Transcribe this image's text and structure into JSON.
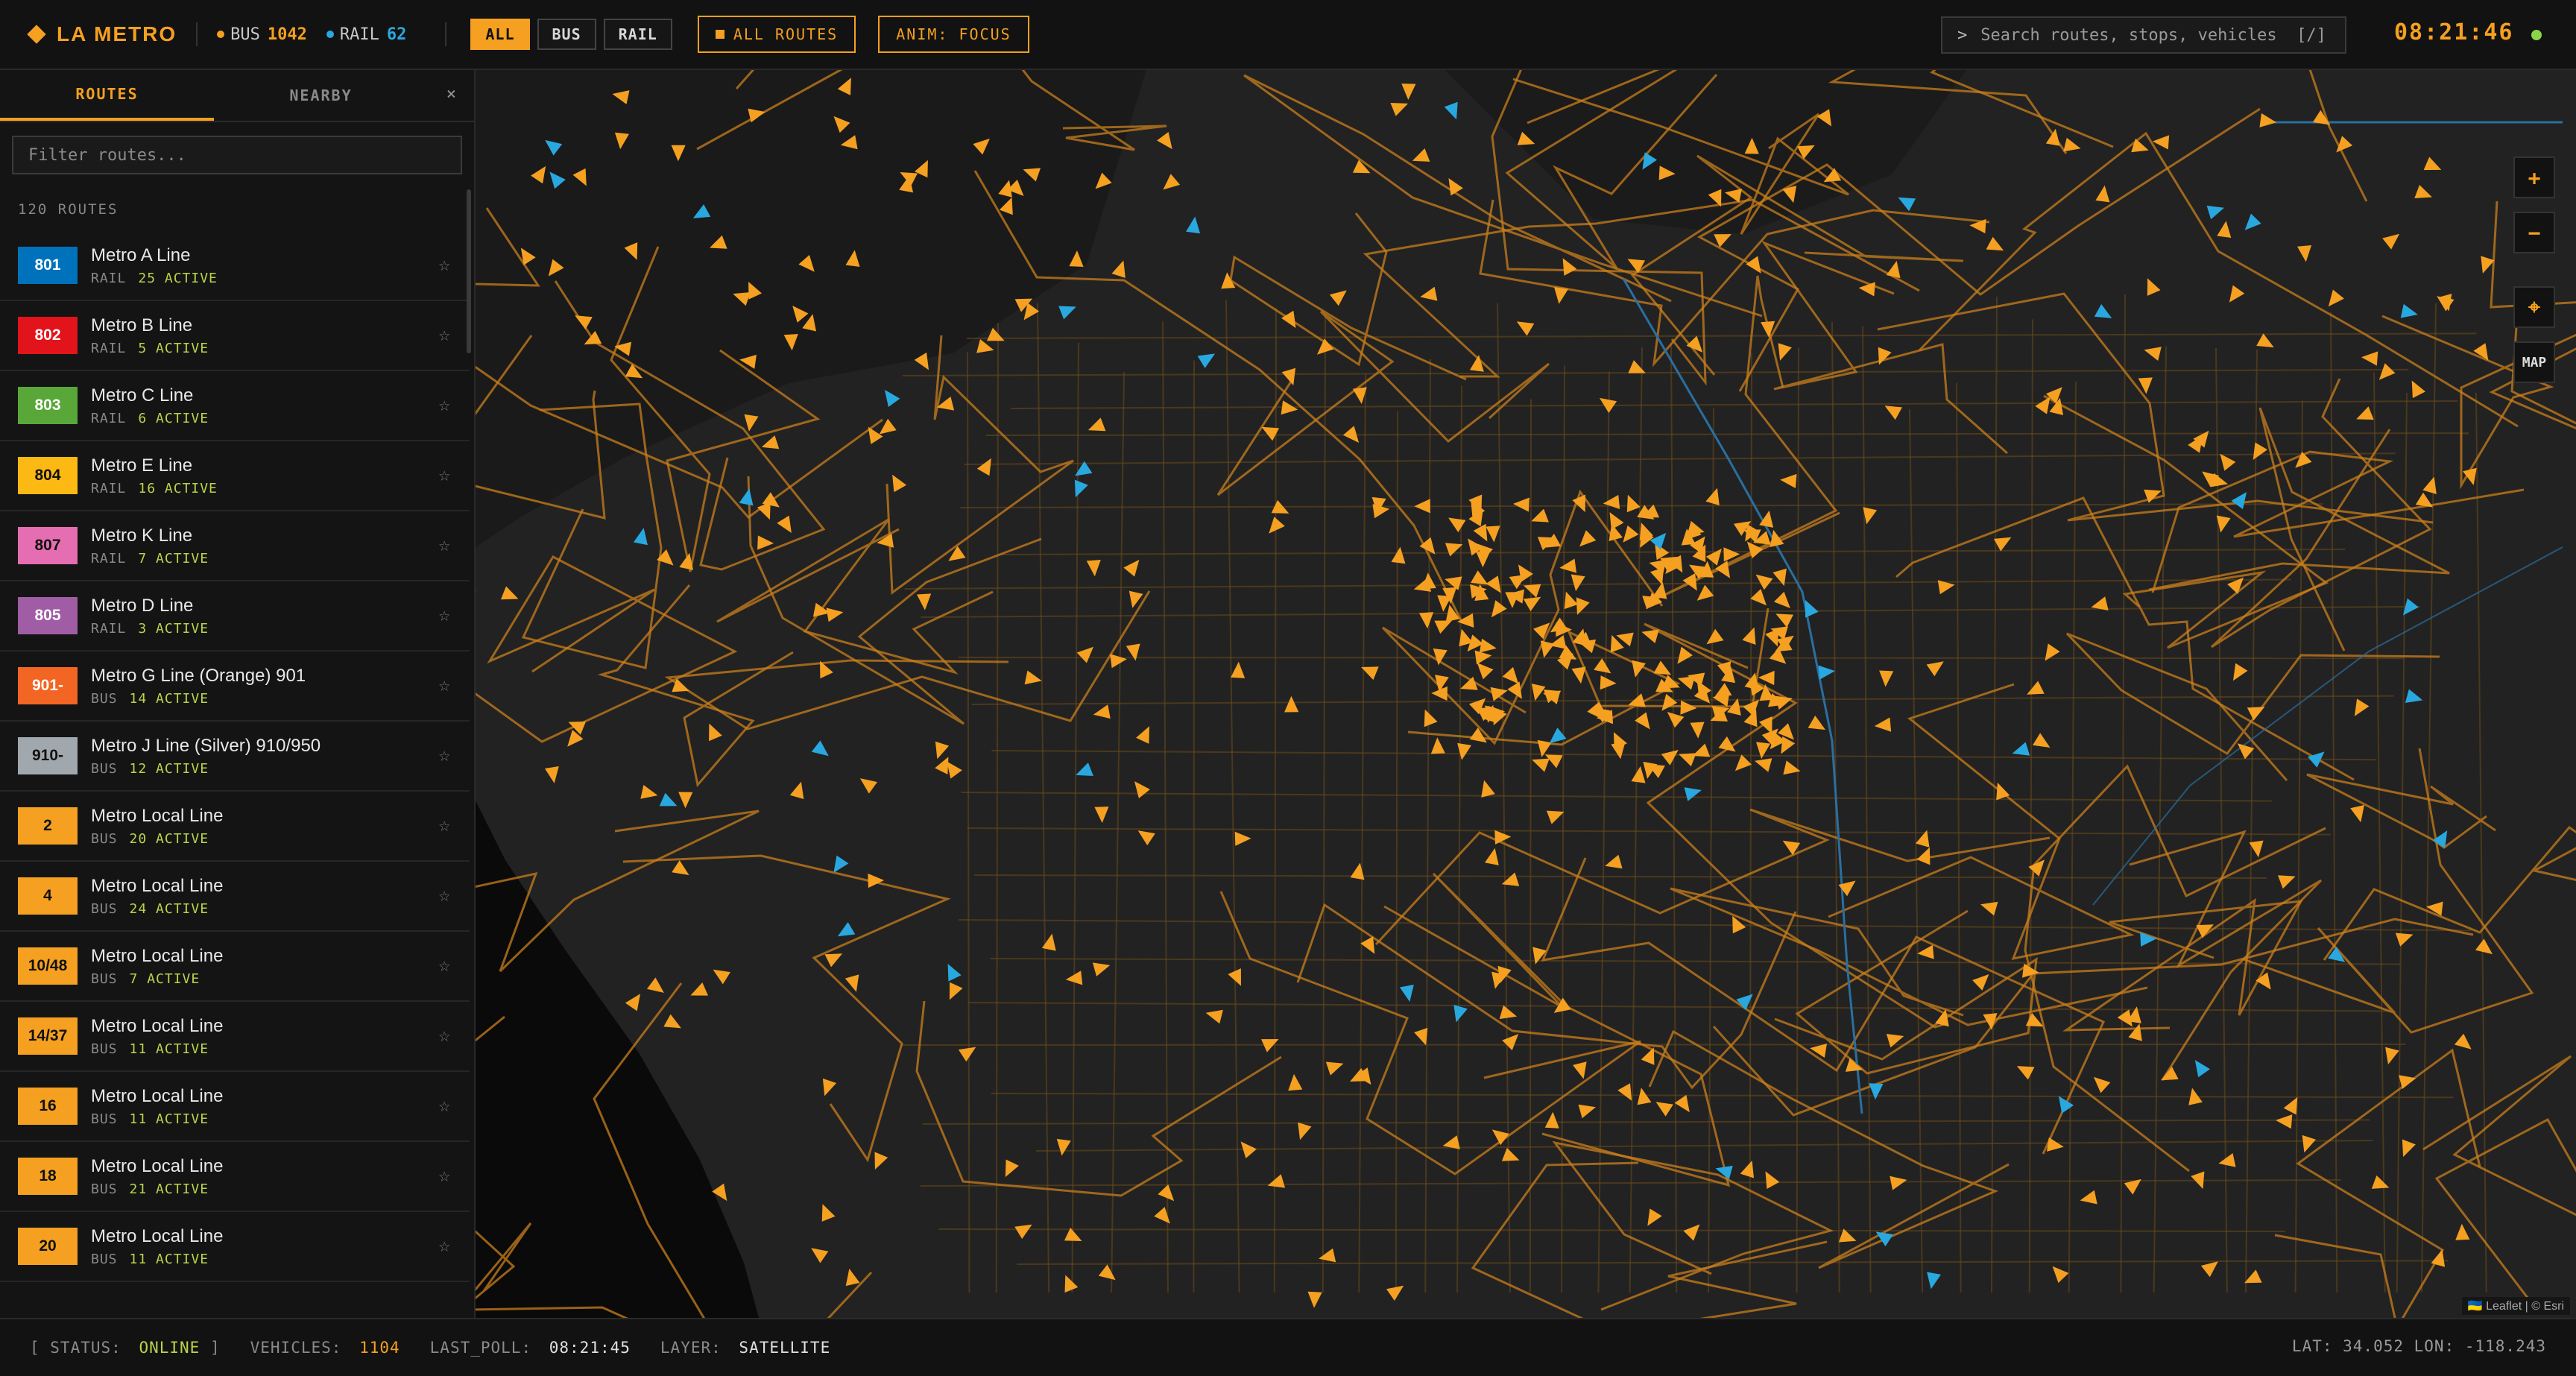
{
  "app": {
    "name": "LA METRO"
  },
  "counts": {
    "bus_label": "BUS",
    "bus_value": "1042",
    "rail_label": "RAIL",
    "rail_value": "62"
  },
  "filters": {
    "all": "ALL",
    "bus": "BUS",
    "rail": "RAIL",
    "selected": "ALL"
  },
  "buttons": {
    "all_routes": "ALL ROUTES",
    "anim": "ANIM: FOCUS"
  },
  "search": {
    "prompt": ">",
    "placeholder": "Search routes, stops, vehicles  [/]"
  },
  "clock": "08:21:46",
  "sidebar": {
    "tabs": [
      "ROUTES",
      "NEARBY"
    ],
    "close": "×",
    "filter_placeholder": "Filter routes...",
    "route_count": "120 ROUTES",
    "routes": [
      {
        "code": "801",
        "name": "Metro A Line",
        "mode": "RAIL",
        "active": "25 ACTIVE",
        "color": "#0072bc"
      },
      {
        "code": "802",
        "name": "Metro B Line",
        "mode": "RAIL",
        "active": "5 ACTIVE",
        "color": "#e3131b"
      },
      {
        "code": "803",
        "name": "Metro C Line",
        "mode": "RAIL",
        "active": "6 ACTIVE",
        "color": "#58a738"
      },
      {
        "code": "804",
        "name": "Metro E Line",
        "mode": "RAIL",
        "active": "16 ACTIVE",
        "color": "#fdb913"
      },
      {
        "code": "807",
        "name": "Metro K Line",
        "mode": "RAIL",
        "active": "7 ACTIVE",
        "color": "#e56db1"
      },
      {
        "code": "805",
        "name": "Metro D Line",
        "mode": "RAIL",
        "active": "3 ACTIVE",
        "color": "#a05da5"
      },
      {
        "code": "901-",
        "name": "Metro G Line (Orange) 901",
        "mode": "BUS",
        "active": "14 ACTIVE",
        "color": "#f26522"
      },
      {
        "code": "910-",
        "name": "Metro J Line (Silver) 910/950",
        "mode": "BUS",
        "active": "12 ACTIVE",
        "color": "#a1a8ad"
      },
      {
        "code": "2",
        "name": "Metro Local Line",
        "mode": "BUS",
        "active": "20 ACTIVE",
        "color": "#f5a020"
      },
      {
        "code": "4",
        "name": "Metro Local Line",
        "mode": "BUS",
        "active": "24 ACTIVE",
        "color": "#f5a020"
      },
      {
        "code": "10/48",
        "name": "Metro Local Line",
        "mode": "BUS",
        "active": "7 ACTIVE",
        "color": "#f5a020"
      },
      {
        "code": "14/37",
        "name": "Metro Local Line",
        "mode": "BUS",
        "active": "11 ACTIVE",
        "color": "#f5a020"
      },
      {
        "code": "16",
        "name": "Metro Local Line",
        "mode": "BUS",
        "active": "11 ACTIVE",
        "color": "#f5a020"
      },
      {
        "code": "18",
        "name": "Metro Local Line",
        "mode": "BUS",
        "active": "21 ACTIVE",
        "color": "#f5a020"
      },
      {
        "code": "20",
        "name": "Metro Local Line",
        "mode": "BUS",
        "active": "11 ACTIVE",
        "color": "#f5a020"
      }
    ]
  },
  "map": {
    "controls": {
      "zoom_in": "+",
      "zoom_out": "−",
      "locate": "⌖",
      "layer": "MAP"
    },
    "attribution": "🇺🇦 Leaflet | © Esri",
    "bus_color": "#f5a020",
    "rail_color": "#29a8e0"
  },
  "status": {
    "status_open": "[ STATUS:",
    "status_value": "ONLINE",
    "status_close": "]",
    "vehicles_label": "VEHICLES:",
    "vehicles_value": "1104",
    "poll_label": "LAST_POLL:",
    "poll_value": "08:21:45",
    "layer_label": "LAYER:",
    "layer_value": "SATELLITE",
    "coords": "LAT: 34.052  LON: -118.243"
  },
  "colors": {
    "accent": "#f5a020",
    "online": "#b8d44a"
  }
}
